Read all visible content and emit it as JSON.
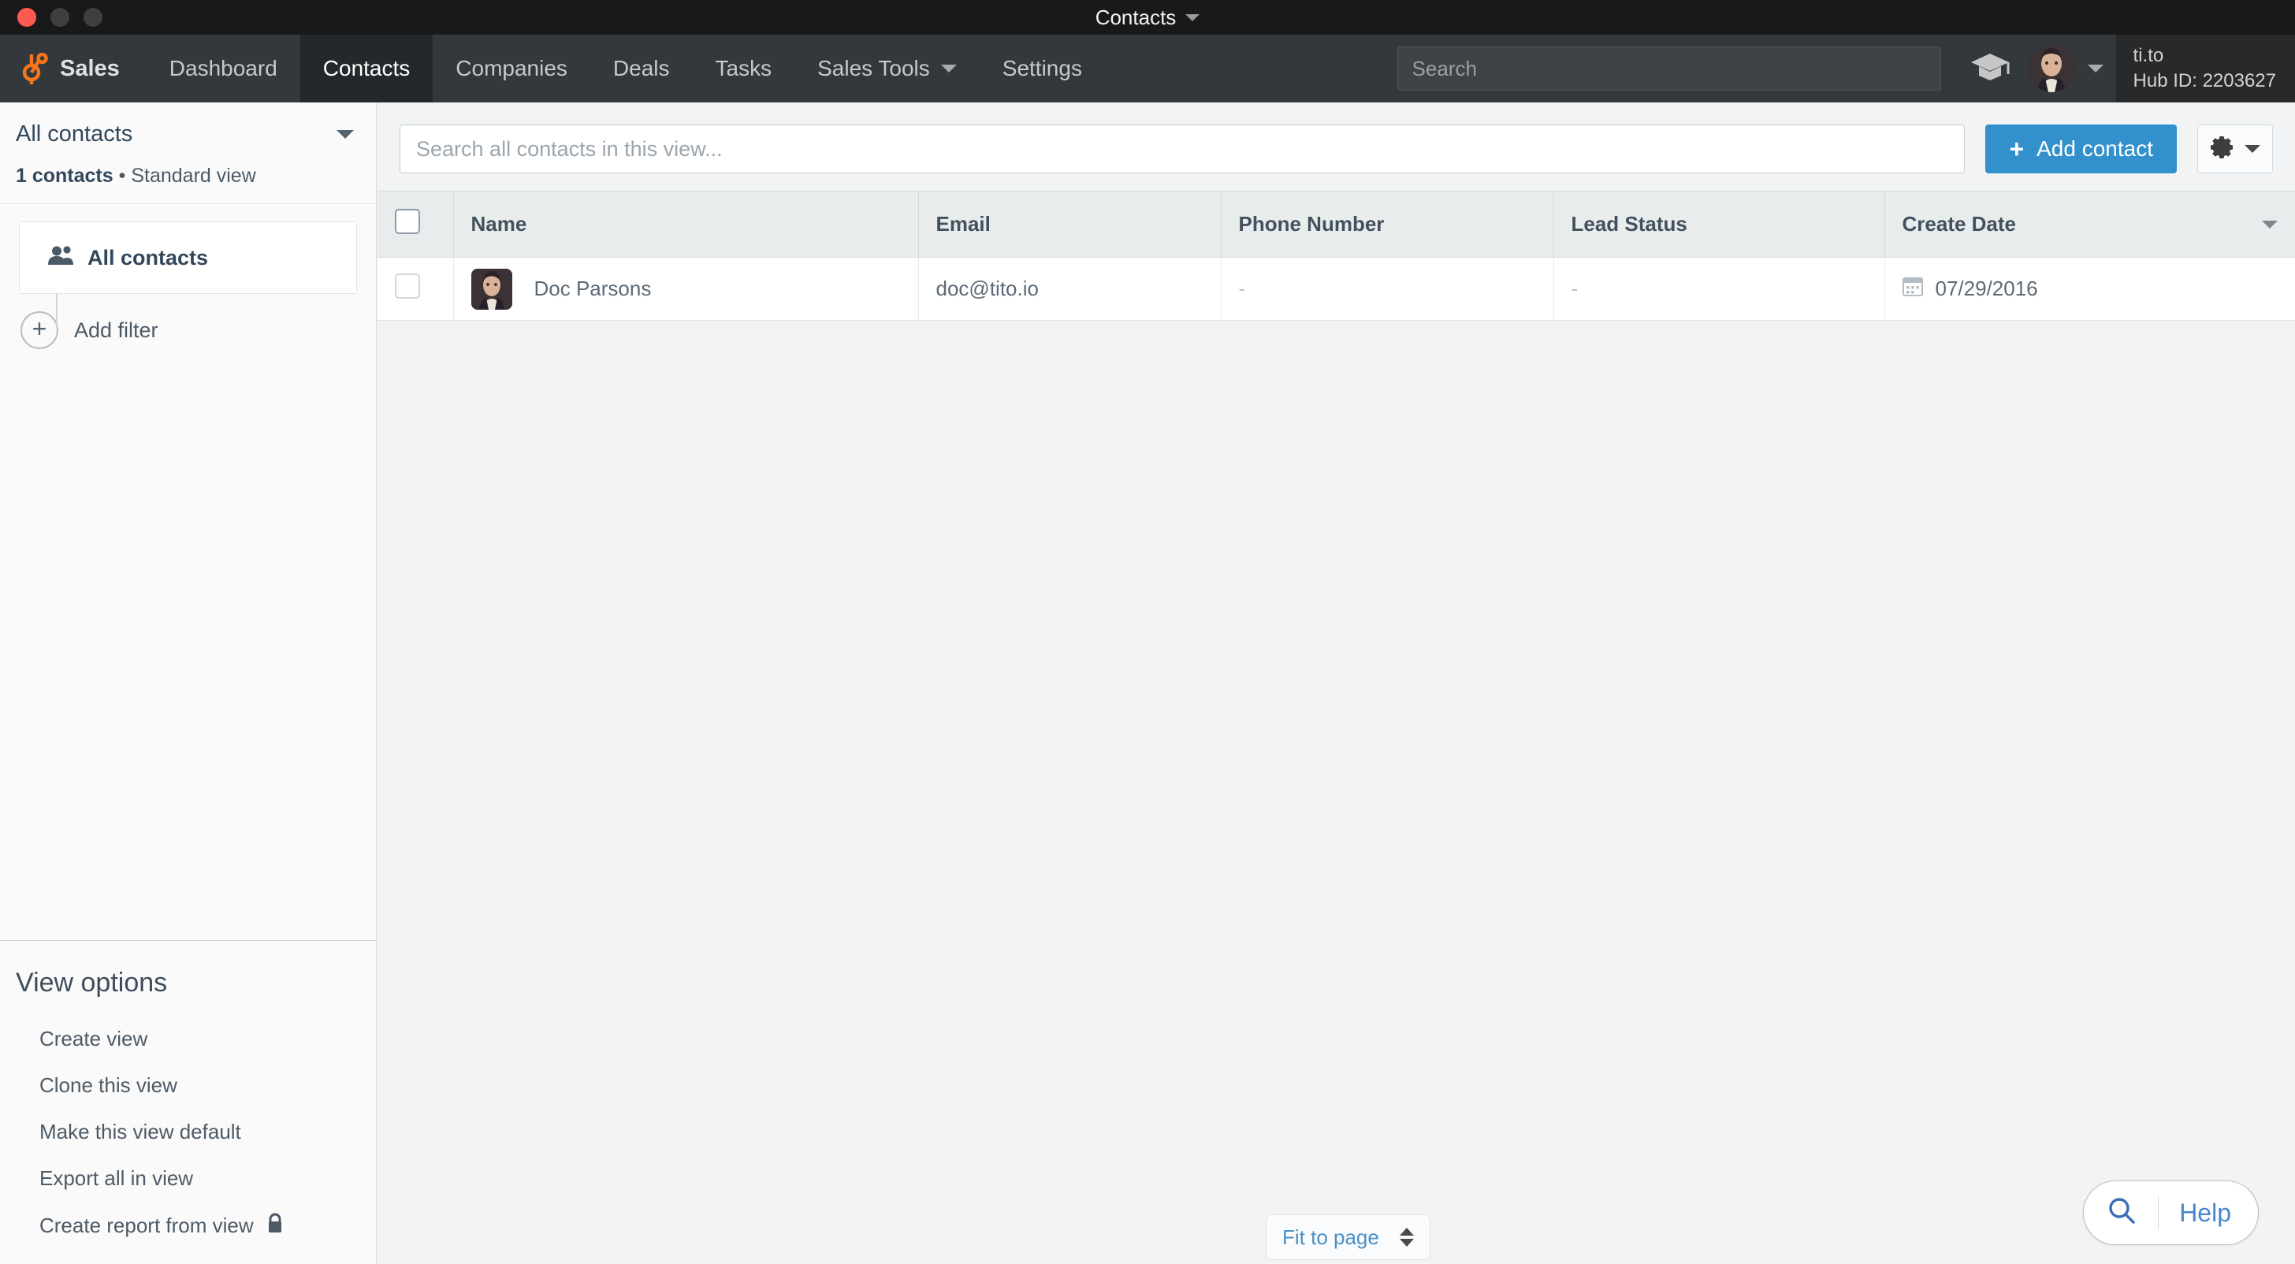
{
  "window": {
    "title": "Contacts",
    "traffic_lights": [
      "close",
      "minimize",
      "maximize"
    ],
    "title_caret_icon": "chevron-down-icon"
  },
  "navbar": {
    "brand": "Sales",
    "brand_logo_icon": "hubspot-sprocket-icon",
    "items": [
      {
        "label": "Dashboard",
        "active": false,
        "caret": false
      },
      {
        "label": "Contacts",
        "active": true,
        "caret": false
      },
      {
        "label": "Companies",
        "active": false,
        "caret": false
      },
      {
        "label": "Deals",
        "active": false,
        "caret": false
      },
      {
        "label": "Tasks",
        "active": false,
        "caret": false
      },
      {
        "label": "Sales Tools",
        "active": false,
        "caret": true
      },
      {
        "label": "Settings",
        "active": false,
        "caret": false
      }
    ],
    "search": {
      "value": "",
      "placeholder": "Search"
    },
    "academy_icon": "graduation-cap-icon",
    "avatar_icon": "user-avatar",
    "account_caret_icon": "chevron-down-icon",
    "account": {
      "name": "ti.to",
      "hub_id": "Hub ID: 2203627"
    }
  },
  "sidebar": {
    "view_name": "All contacts",
    "view_caret_icon": "chevron-down-icon",
    "summary_count": "1 contacts",
    "summary_separator": " • ",
    "summary_view": "Standard view",
    "filter_card": {
      "label": "All contacts",
      "icon": "contacts-people-icon"
    },
    "add_filter": {
      "label": "Add filter",
      "icon": "plus-circle-icon"
    },
    "view_options": {
      "heading": "View options",
      "items": [
        {
          "label": "Create view",
          "lock": false
        },
        {
          "label": "Clone this view",
          "lock": false
        },
        {
          "label": "Make this view default",
          "lock": false
        },
        {
          "label": "Export all in view",
          "lock": false
        },
        {
          "label": "Create report from view",
          "lock": true
        }
      ]
    }
  },
  "toolbar": {
    "search": {
      "value": "",
      "placeholder": "Search all contacts in this view..."
    },
    "add_contact_label": "Add contact",
    "add_contact_plus": "+",
    "gear_icon": "gear-icon",
    "gear_caret_icon": "chevron-down-icon"
  },
  "table": {
    "select_all_checkbox": "unchecked",
    "columns": [
      {
        "key": "name",
        "label": "Name"
      },
      {
        "key": "email",
        "label": "Email"
      },
      {
        "key": "phone",
        "label": "Phone Number"
      },
      {
        "key": "lead",
        "label": "Lead Status"
      },
      {
        "key": "date",
        "label": "Create Date",
        "sort_caret_icon": "caret-down-icon"
      }
    ],
    "rows": [
      {
        "checkbox": "unchecked",
        "avatar_icon": "contact-avatar",
        "name": "Doc Parsons",
        "email": "doc@tito.io",
        "phone": "-",
        "lead": "-",
        "date_icon": "calendar-icon",
        "date": "07/29/2016"
      }
    ]
  },
  "footer": {
    "fit_to_page_label": "Fit to page",
    "fit_to_page_spinner_icon": "up-down-spinner-icon",
    "help_label": "Help",
    "help_search_icon": "search-icon"
  },
  "colors": {
    "titlebar_bg": "#191919",
    "navbar_bg": "#33383c",
    "nav_active_bg": "#25282b",
    "brand_orange": "#f5761a",
    "primary_blue": "#3291cd",
    "link_blue": "#4a86cc",
    "sidebar_bg": "#fafafa",
    "main_bg": "#f1f3f4",
    "table_header_bg": "#e8ecec",
    "text_dark": "#33475b",
    "close_red": "#ff5a52"
  }
}
